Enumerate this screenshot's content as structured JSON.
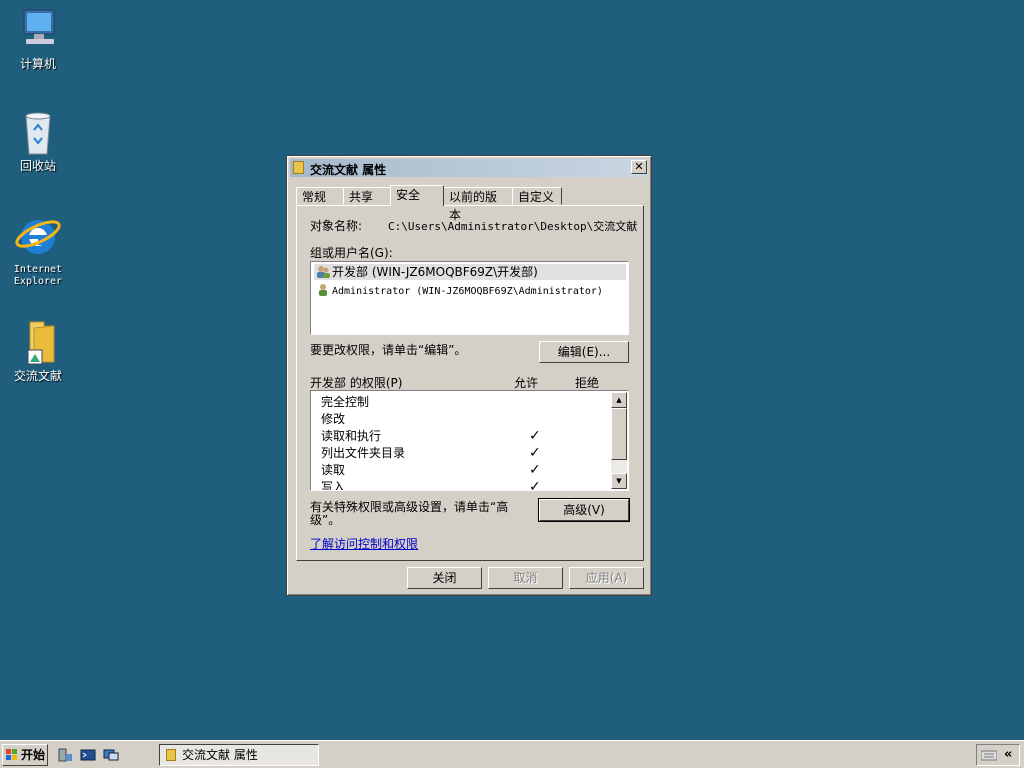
{
  "desktop": {
    "icons": [
      {
        "label": "计算机"
      },
      {
        "label": "回收站"
      },
      {
        "label": "Internet\nExplorer"
      },
      {
        "label": "交流文献"
      }
    ]
  },
  "dialog": {
    "title": "交流文献 属性",
    "close_glyph": "✕",
    "tabs": [
      "常规",
      "共享",
      "安全",
      "以前的版本",
      "自定义"
    ],
    "active_tab": "安全",
    "object_name_label": "对象名称:",
    "object_name_value": "C:\\Users\\Administrator\\Desktop\\交流文献",
    "group_label": "组或用户名(G):",
    "users": [
      {
        "name": "开发部 (WIN-JZ6MOQBF69Z\\开发部)",
        "selected": true
      },
      {
        "name": "Administrator (WIN-JZ6MOQBF69Z\\Administrator)",
        "selected": false
      }
    ],
    "change_perm_text": "要更改权限，请单击“编辑”。",
    "edit_button": "编辑(E)...",
    "perm_header": "开发部 的权限(P)",
    "allow_header": "允许",
    "deny_header": "拒绝",
    "permissions": [
      {
        "name": "完全控制",
        "allow": ""
      },
      {
        "name": "修改",
        "allow": ""
      },
      {
        "name": "读取和执行",
        "allow": "✓"
      },
      {
        "name": "列出文件夹目录",
        "allow": "✓"
      },
      {
        "name": "读取",
        "allow": "✓"
      },
      {
        "name": "写入",
        "allow": "✓"
      }
    ],
    "special_text_1": "有关特殊权限或高级设置，请单击“高",
    "special_text_2": "级”。",
    "advanced_button": "高级(V)",
    "learn_link": "了解访问控制和权限",
    "close_button": "关闭",
    "cancel_button": "取消",
    "apply_button": "应用(A)"
  },
  "taskbar": {
    "start_label": "开始",
    "task_item": "交流文献 属性",
    "tray_chevron": "«"
  }
}
